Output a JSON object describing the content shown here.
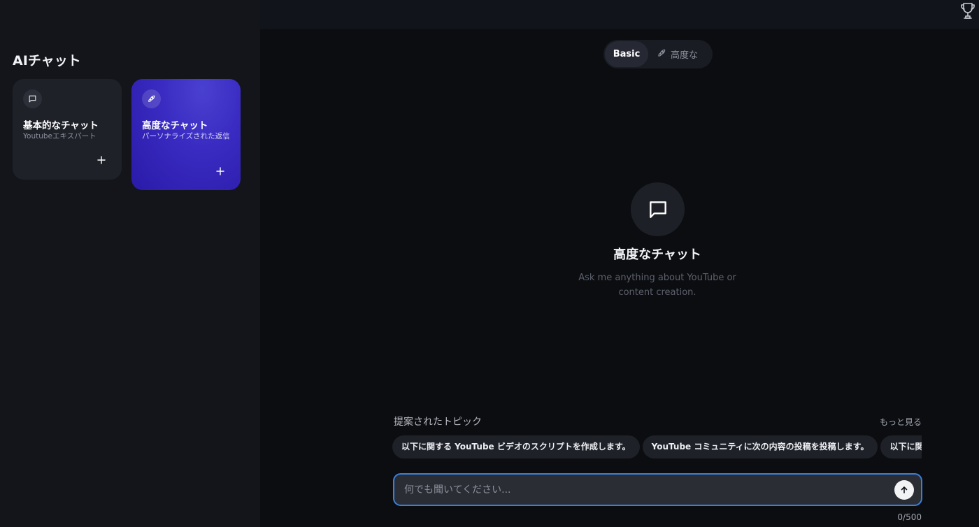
{
  "topbar": {
    "trophy_icon": "trophy-icon"
  },
  "sidebar": {
    "title": "AIチャット",
    "cards": [
      {
        "title": "基本的なチャット",
        "subtitle": "Youtubeエキスパート",
        "icon": "message-square-icon",
        "action_icon": "plus-icon"
      },
      {
        "title": "高度なチャット",
        "subtitle": "パーソナライズされた返信",
        "icon": "rocket-icon",
        "action_icon": "plus-icon"
      }
    ]
  },
  "mode_toggle": {
    "basic_label": "Basic",
    "advanced_label": "高度な",
    "advanced_icon": "rocket-icon",
    "selected": "Basic"
  },
  "empty_state": {
    "icon": "message-square-icon",
    "title": "高度なチャット",
    "subtitle": "Ask me anything about YouTube or content creation."
  },
  "topics": {
    "label": "提案されたトピック",
    "more_label": "もっと見る",
    "chips": [
      "以下に関する YouTube ビデオのスクリプトを作成します。",
      "YouTube コミュニティに次の内容の投稿を投稿します。",
      "以下に関する YouTube ビデオのタイトルを作成します。"
    ]
  },
  "input": {
    "placeholder": "何でも聞いてください...",
    "value": "",
    "send_icon": "arrow-up-icon",
    "char_count": "0/500"
  },
  "colors": {
    "background": "#0c0d11",
    "sidebar": "#13151b",
    "accent_card": "#3a2cc2",
    "input_border": "#3b7fd9"
  }
}
